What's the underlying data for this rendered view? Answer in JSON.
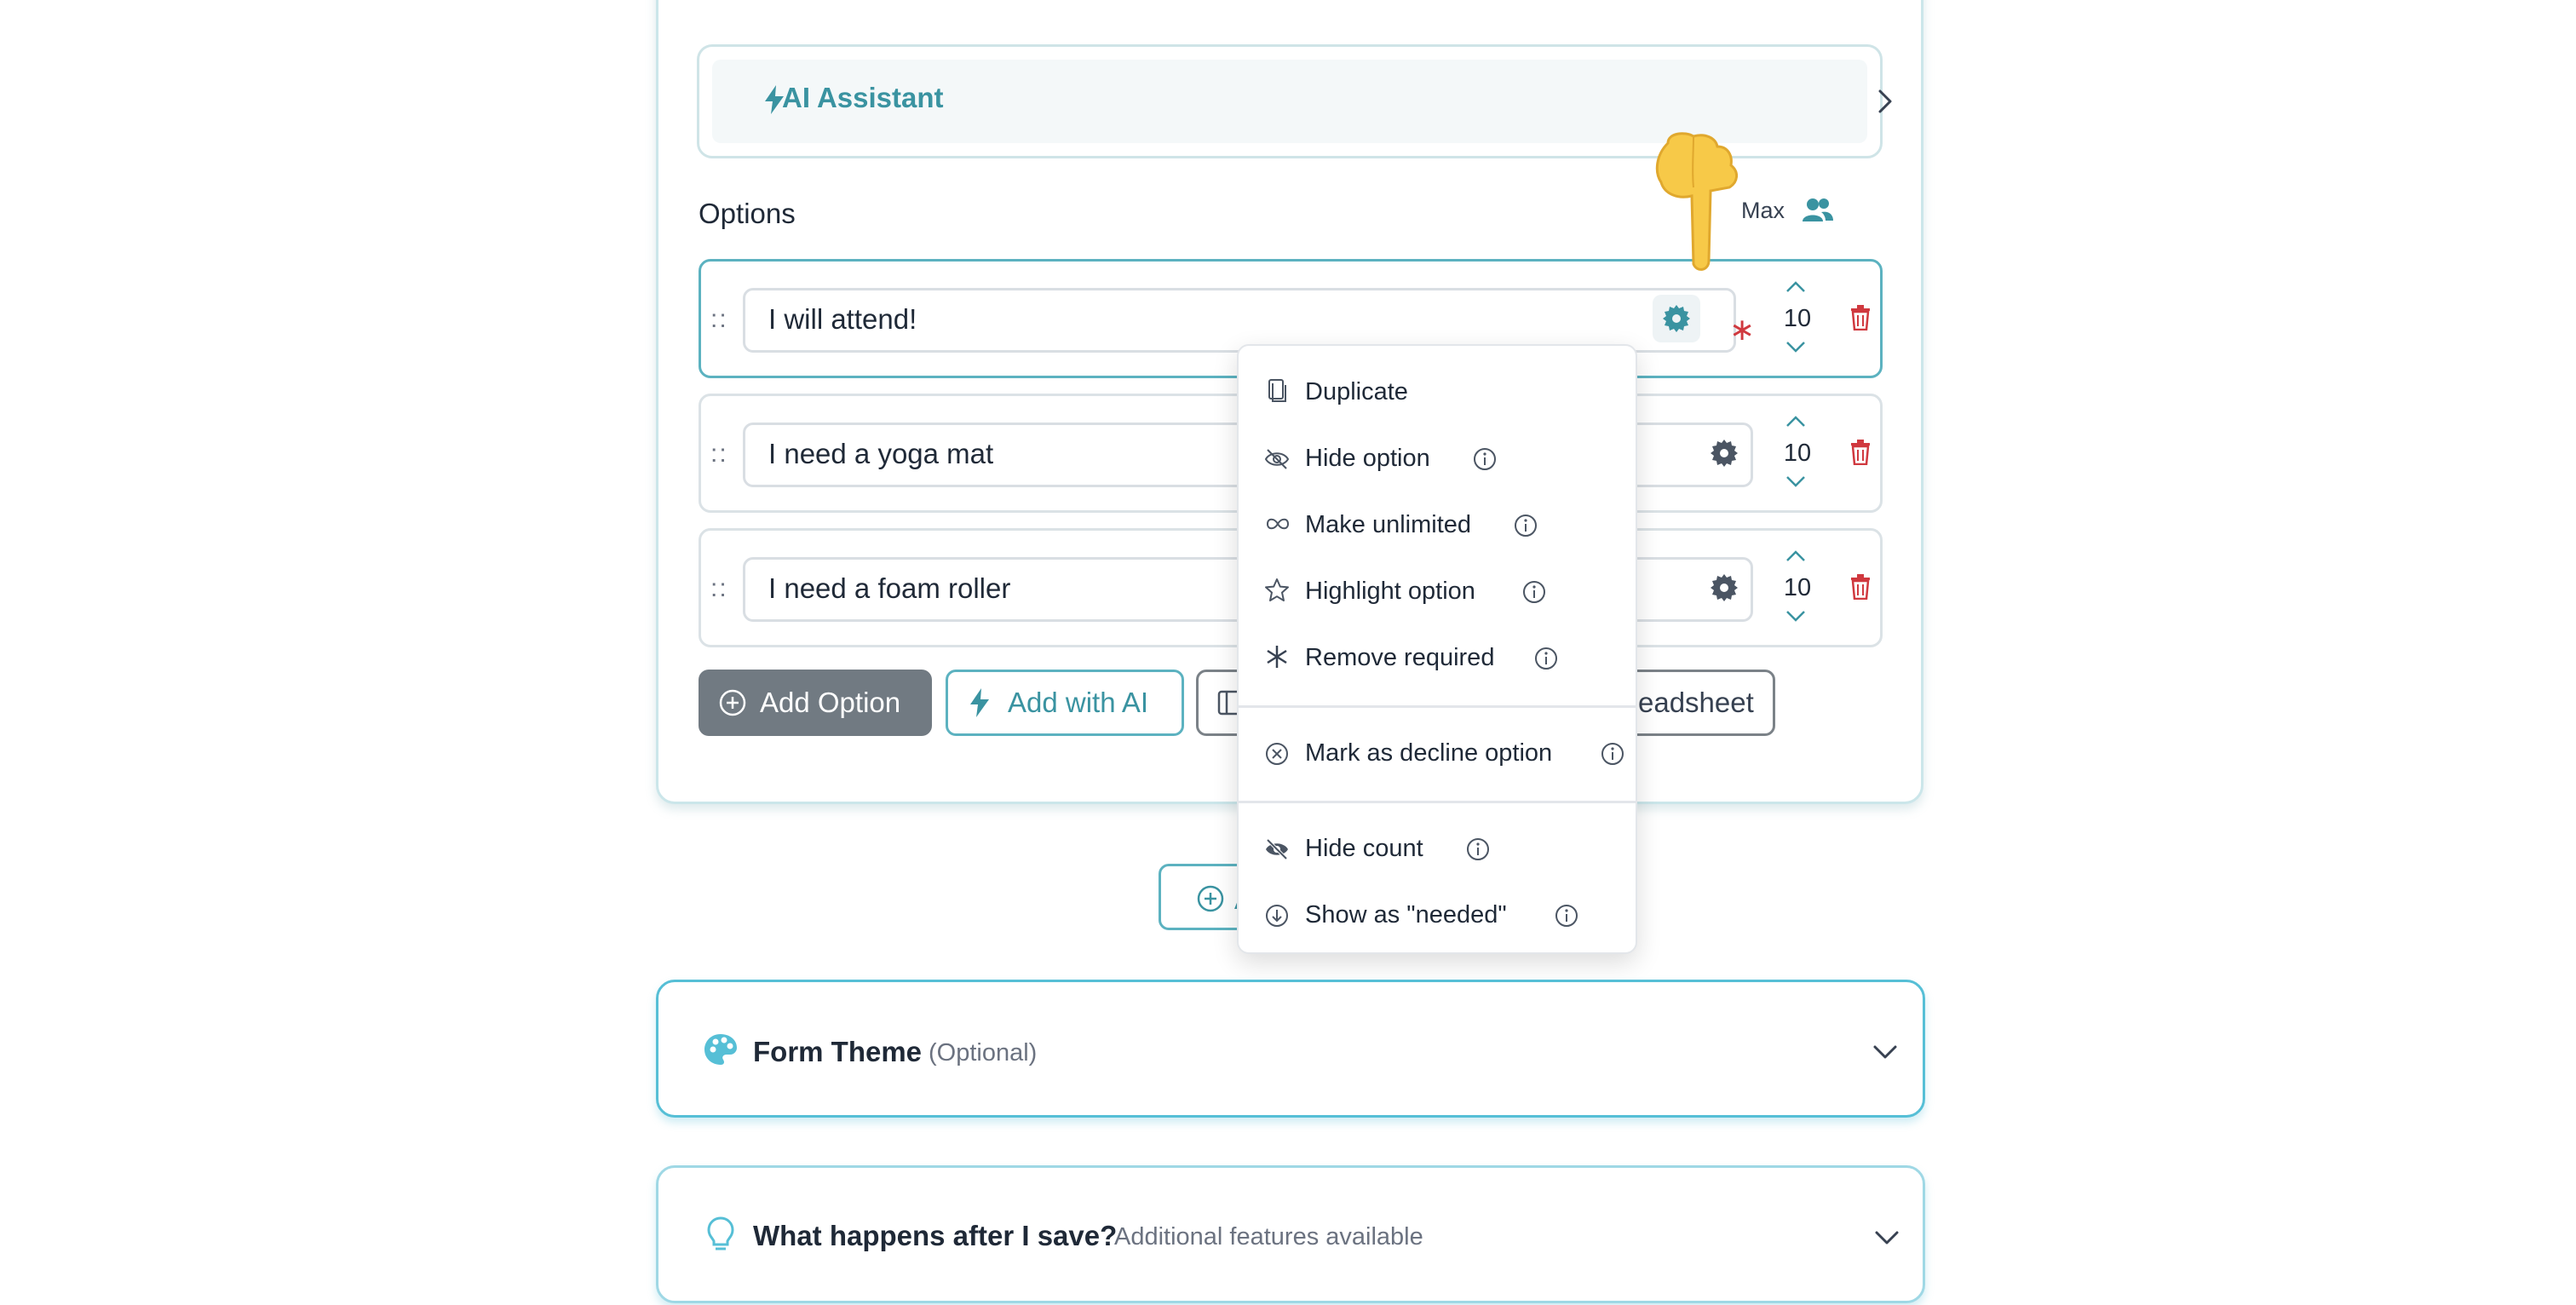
{
  "ai_assistant": {
    "label": "AI Assistant"
  },
  "options": {
    "heading": "Options",
    "max_label": "Max",
    "rows": [
      {
        "text": "I will attend!",
        "max": "10",
        "required": true
      },
      {
        "text": "I need a yoga mat",
        "max": "10",
        "required": false
      },
      {
        "text": "I need a foam roller",
        "max": "10",
        "required": false
      }
    ],
    "drag_handle": "::"
  },
  "buttons": {
    "add_option": "Add Option",
    "add_with_ai": "Add with AI",
    "spreadsheet_partial": "eadsheet",
    "below_partial": "A"
  },
  "menu": {
    "items": [
      {
        "label": "Duplicate",
        "icon": "copy-icon",
        "info": false
      },
      {
        "label": "Hide option",
        "icon": "eye-off-icon",
        "info": true
      },
      {
        "label": "Make unlimited",
        "icon": "infinity-icon",
        "info": true
      },
      {
        "label": "Highlight option",
        "icon": "star-icon",
        "info": true
      },
      {
        "label": "Remove required",
        "icon": "asterisk-icon",
        "info": true
      },
      {
        "label": "Mark as decline option",
        "icon": "x-circle-icon",
        "info": true
      },
      {
        "label": "Hide count",
        "icon": "eye-off-icon",
        "info": true
      },
      {
        "label": "Show as \"needed\"",
        "icon": "arrow-down-circle-icon",
        "info": true
      }
    ]
  },
  "sections": {
    "form_theme": {
      "title": "Form Theme",
      "subtitle": "(Optional)"
    },
    "after_save": {
      "title": "What happens after I save?",
      "subtitle": "Additional features available"
    }
  },
  "colors": {
    "accent": "#3a93a1",
    "danger": "#d0393f",
    "section_border": "#56bfd6"
  }
}
